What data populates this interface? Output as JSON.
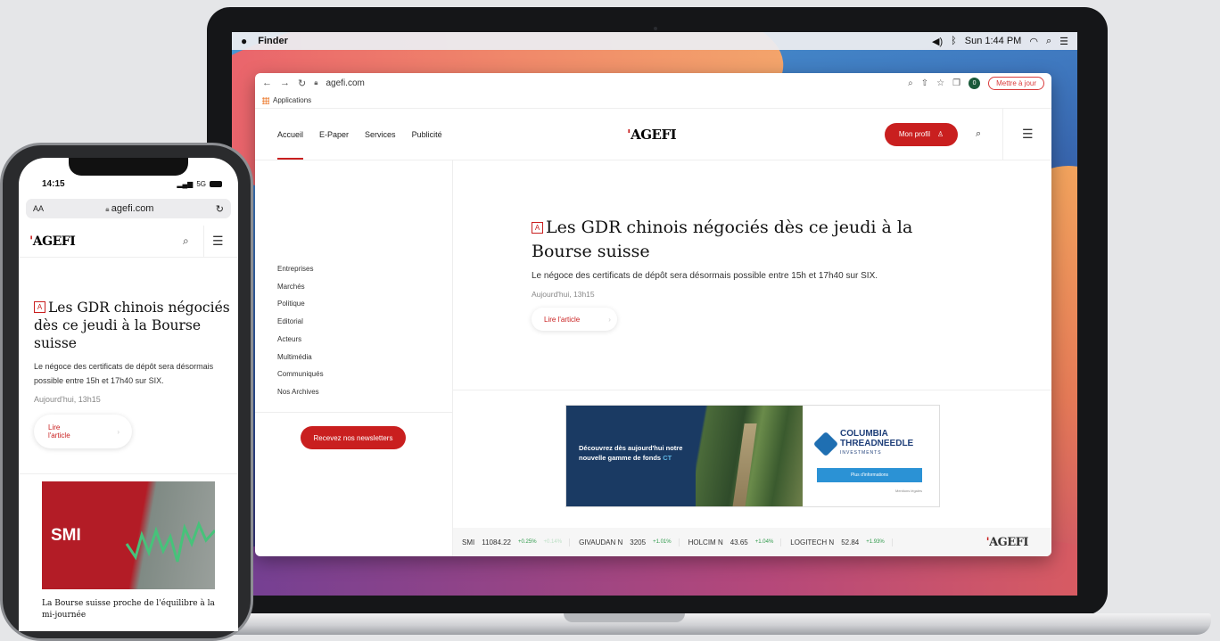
{
  "menubar": {
    "app": "Finder",
    "clock": "Sun 1:44 PM"
  },
  "browser": {
    "url": "agefi.com",
    "bookmark": "Applications",
    "profile_initial": "0",
    "update_label": "Mettre à jour"
  },
  "site": {
    "logo": "AGEFI",
    "nav": [
      "Accueil",
      "E-Paper",
      "Services",
      "Publicité"
    ],
    "profile_label": "Mon profil",
    "sections": [
      "Entreprises",
      "Marchés",
      "Politique",
      "Editorial",
      "Acteurs",
      "Multimédia",
      "Communiqués",
      "Nos Archives"
    ],
    "newsletter_label": "Recevez nos newsletters"
  },
  "article": {
    "badge": "A",
    "title": "Les GDR chinois négociés dès ce jeudi à la Bourse suisse",
    "lede": "Le négoce des certificats de dépôt sera désormais possible entre 15h et 17h40 sur SIX.",
    "date": "Aujourd'hui, 13h15",
    "read_label": "Lire l'article"
  },
  "ad": {
    "text": "Découvrez dès aujourd'hui notre nouvelle gamme de fonds",
    "text_ct": "CT",
    "brand_line1": "COLUMBIA",
    "brand_line2": "THREADNEEDLE",
    "brand_sub": "INVESTMENTS",
    "button": "Plus d'informations",
    "fine_print": "Mentions légales"
  },
  "ticker": [
    {
      "symbol": "SMI",
      "value": "11084.22",
      "change": "+0.25%",
      "faint": "+0.14%"
    },
    {
      "symbol": "GIVAUDAN N",
      "value": "3205",
      "change": "+1.01%"
    },
    {
      "symbol": "HOLCIM N",
      "value": "43.65",
      "change": "+1.04%"
    },
    {
      "symbol": "LOGITECH N",
      "value": "52.84",
      "change": "+1.93%"
    }
  ],
  "phone": {
    "time": "14:15",
    "network": "5G",
    "aa": "AA",
    "url": "agefi.com",
    "read_line1": "Lire",
    "read_line2": "l'article",
    "card_label": "SMI",
    "card_title": "La Bourse suisse proche de l'équilibre à la mi-journée"
  },
  "colors": {
    "brand_red": "#c91f1f",
    "ticker_up": "#2e9a4a",
    "ad_navy": "#1a3a63"
  }
}
